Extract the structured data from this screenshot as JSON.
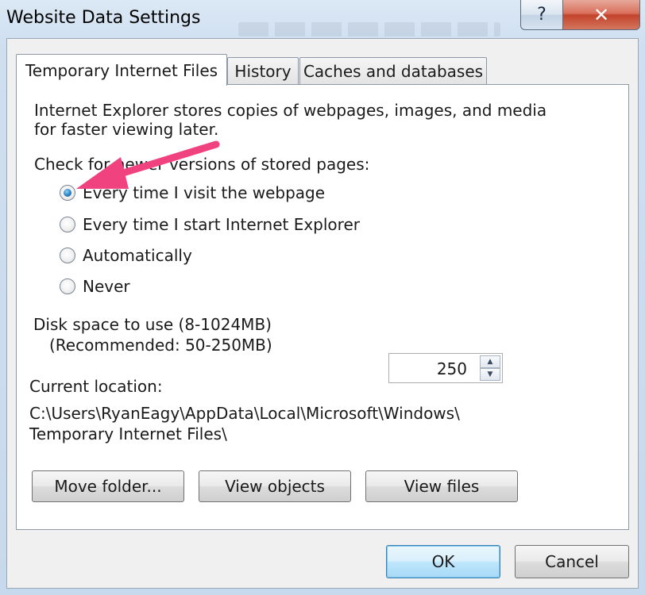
{
  "window": {
    "title": "Website Data Settings",
    "help_glyph": "?",
    "close_glyph": "✕"
  },
  "tabs": [
    {
      "label": "Temporary Internet Files",
      "active": true
    },
    {
      "label": "History",
      "active": false
    },
    {
      "label": "Caches and databases",
      "active": false
    }
  ],
  "panel": {
    "description_line1": "Internet Explorer stores copies of webpages, images, and media",
    "description_line2": "for faster viewing later.",
    "check_heading": "Check for newer versions of stored pages:",
    "radio_options": [
      {
        "label": "Every time I visit the webpage",
        "checked": true
      },
      {
        "label": "Every time I start Internet Explorer",
        "checked": false
      },
      {
        "label": "Automatically",
        "checked": false
      },
      {
        "label": "Never",
        "checked": false
      }
    ],
    "disk_space_label": "Disk space to use (8-1024MB)",
    "disk_space_recommended": "(Recommended: 50-250MB)",
    "disk_space_value": "250",
    "current_location_label": "Current location:",
    "location_line1": "C:\\Users\\RyanEagy\\AppData\\Local\\Microsoft\\Windows\\",
    "location_line2": "Temporary Internet Files\\",
    "buttons": {
      "move_folder": "Move folder...",
      "view_objects": "View objects",
      "view_files": "View files"
    }
  },
  "footer": {
    "ok": "OK",
    "cancel": "Cancel"
  },
  "annotation": {
    "arrow_color": "#f0427f"
  }
}
